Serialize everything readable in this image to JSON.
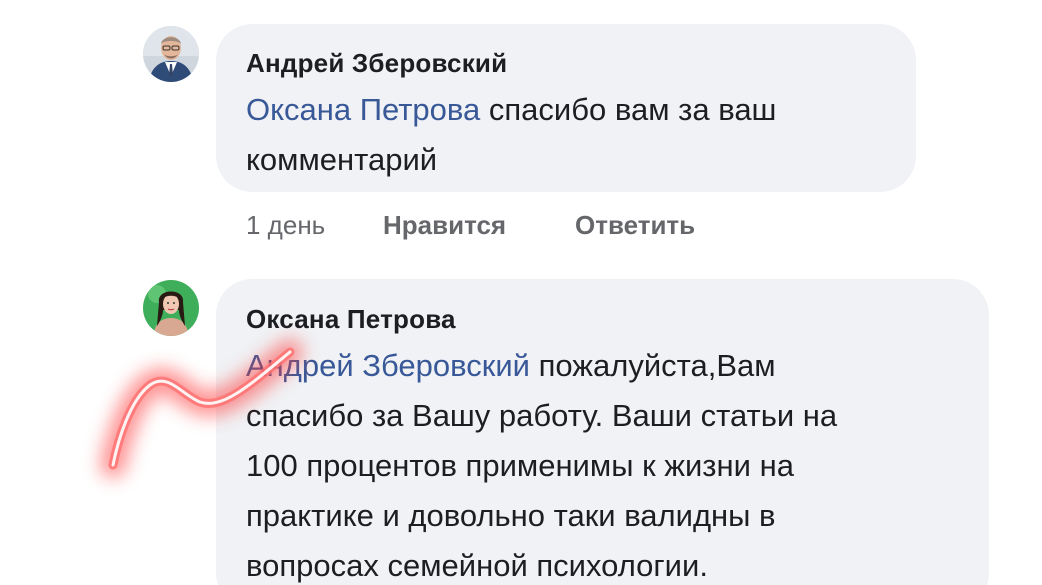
{
  "comments": [
    {
      "author": "Андрей Зберовский",
      "mention": "Оксана Петрова",
      "text_line1_rest": " спасибо вам за ваш",
      "text_line2": "комментарий",
      "time": "1 день",
      "like_label": "Нравится",
      "reply_label": "Ответить",
      "avatar_icon": "man-in-suit-avatar"
    },
    {
      "author": "Оксана Петрова",
      "mention": "Андрей Зберовский",
      "text_line1_rest": " пожалуйста,Вам",
      "text_line2": "спасибо за Вашу работу. Ваши статьи на",
      "text_line3": "100 процентов применимы к жизни на",
      "text_line4": "практике и довольно таки валидны в",
      "text_line5": "вопросах семейной психологии.",
      "avatar_icon": "woman-green-background-avatar"
    }
  ],
  "colors": {
    "bubble": "#f0f2f5",
    "mention": "#385898",
    "text": "#1c1e21",
    "meta": "#65676b",
    "scribble": "#ff3b3b"
  }
}
